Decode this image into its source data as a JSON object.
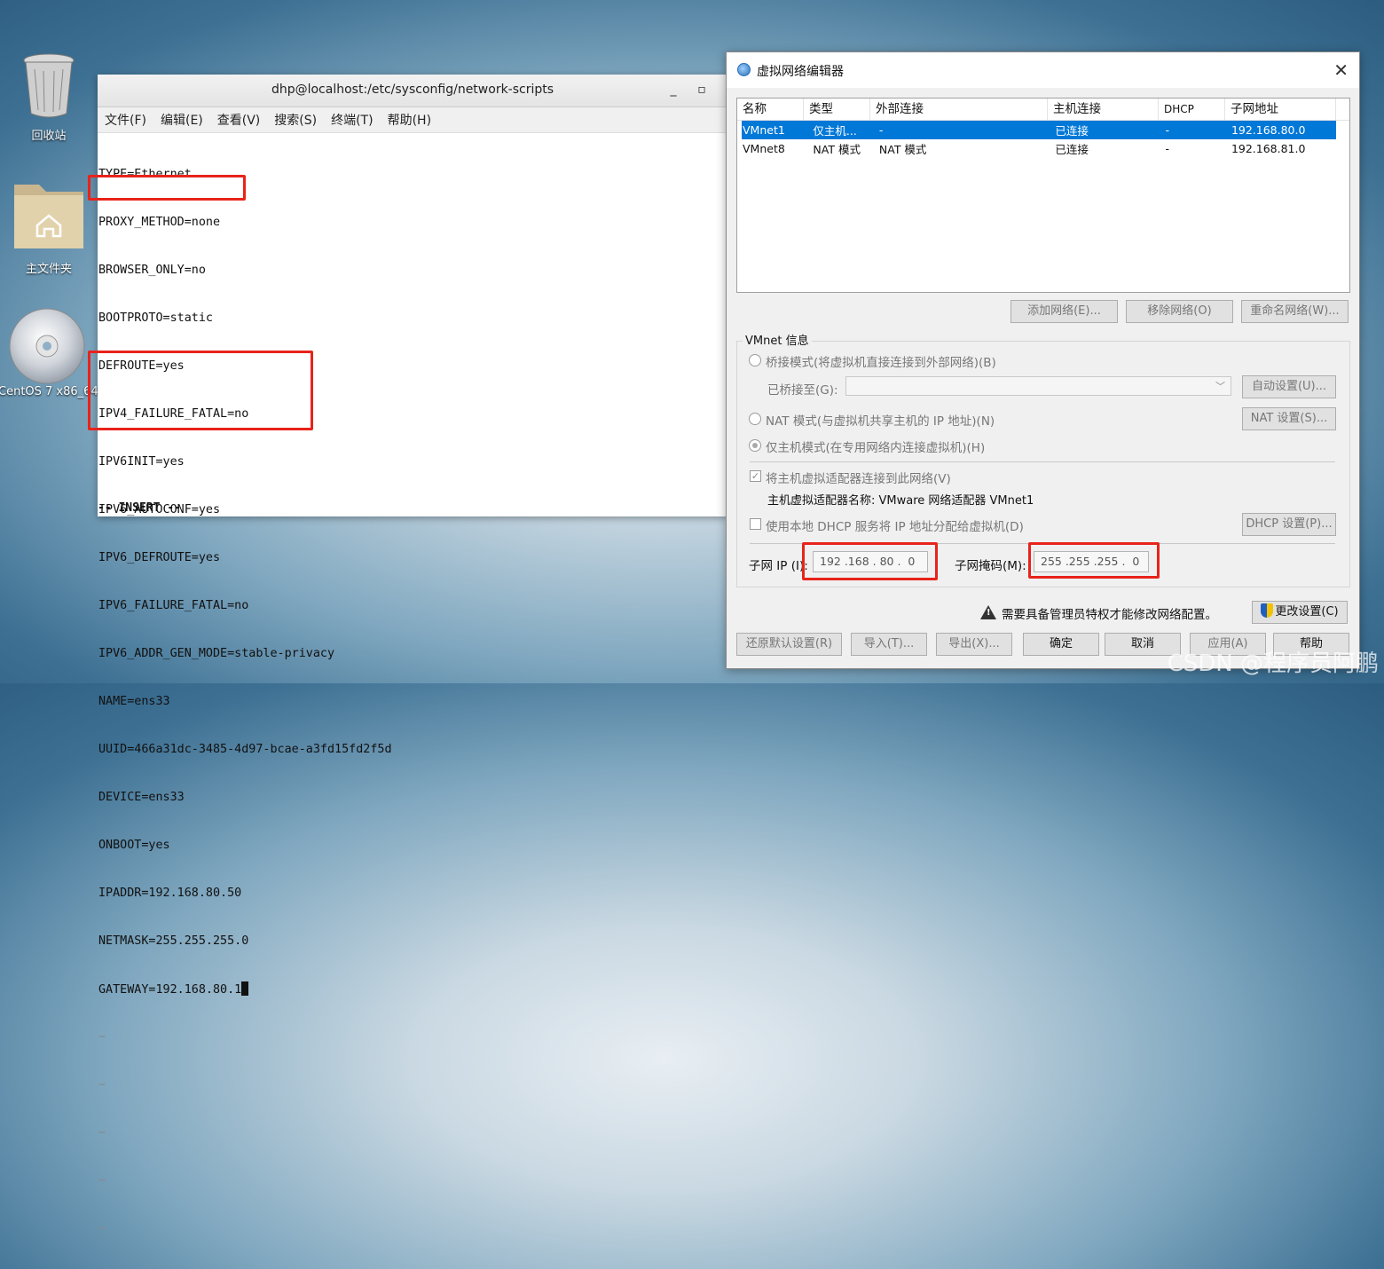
{
  "desktop": {
    "icons": [
      {
        "label": "回收站",
        "icon": "trash-icon"
      },
      {
        "label": "主文件夹",
        "icon": "home-folder-icon"
      },
      {
        "label": "CentOS 7 x86_64",
        "icon": "cd-icon"
      }
    ]
  },
  "terminal": {
    "title": "dhp@localhost:/etc/sysconfig/network-scripts",
    "minimize": "_",
    "maximize": "▫",
    "menu": [
      "文件(F)",
      "编辑(E)",
      "查看(V)",
      "搜索(S)",
      "终端(T)",
      "帮助(H)"
    ],
    "lines": [
      "TYPE=Ethernet",
      "PROXY_METHOD=none",
      "BROWSER_ONLY=no",
      "BOOTPROTO=static",
      "DEFROUTE=yes",
      "IPV4_FAILURE_FATAL=no",
      "IPV6INIT=yes",
      "IPV6_AUTOCONF=yes",
      "IPV6_DEFROUTE=yes",
      "IPV6_FAILURE_FATAL=no",
      "IPV6_ADDR_GEN_MODE=stable-privacy",
      "NAME=ens33",
      "UUID=466a31dc-3485-4d97-bcae-a3fd15fd2f5d",
      "DEVICE=ens33",
      "ONBOOT=yes",
      "IPADDR=192.168.80.50",
      "NETMASK=255.255.255.0",
      "GATEWAY=192.168.80.1"
    ],
    "tildes": [
      "~",
      "~",
      "~",
      "~",
      "~"
    ],
    "mode": "-- INSERT --"
  },
  "dialog": {
    "title": "虚拟网络编辑器",
    "close": "✕",
    "table": {
      "headers": [
        "名称",
        "类型",
        "外部连接",
        "主机连接",
        "DHCP",
        "子网地址"
      ],
      "rows": [
        [
          "VMnet1",
          "仅主机...",
          "-",
          "已连接",
          "-",
          "192.168.80.0"
        ],
        [
          "VMnet8",
          "NAT 模式",
          "NAT 模式",
          "已连接",
          "-",
          "192.168.81.0"
        ]
      ]
    },
    "buttons": {
      "add": "添加网络(E)...",
      "remove": "移除网络(O)",
      "rename": "重命名网络(W)...",
      "auto": "自动设置(U)...",
      "nat": "NAT 设置(S)...",
      "dhcp": "DHCP 设置(P)...",
      "change": "更改设置(C)",
      "restore": "还原默认设置(R)",
      "import": "导入(T)...",
      "export": "导出(X)...",
      "ok": "确定",
      "cancel": "取消",
      "apply": "应用(A)",
      "help": "帮助"
    },
    "info": {
      "group_title": "VMnet 信息",
      "bridge": "桥接模式(将虚拟机直接连接到外部网络)(B)",
      "bridge_to": "已桥接至(G):",
      "nat_mode": "NAT 模式(与虚拟机共享主机的 IP 地址)(N)",
      "host_only": "仅主机模式(在专用网络内连接虚拟机)(H)",
      "connect_adapter": "将主机虚拟适配器连接到此网络(V)",
      "adapter_name": "主机虚拟适配器名称: VMware 网络适配器 VMnet1",
      "use_dhcp": "使用本地 DHCP 服务将 IP 地址分配给虚拟机(D)",
      "subnet_ip_label": "子网 IP (I):",
      "subnet_ip": "192 .168 . 80 .  0",
      "subnet_mask_label": "子网掩码(M):",
      "subnet_mask": "255 .255 .255 .  0"
    },
    "warning": "需要具备管理员特权才能修改网络配置。"
  },
  "watermark": "CSDN @程序员阿鹏"
}
